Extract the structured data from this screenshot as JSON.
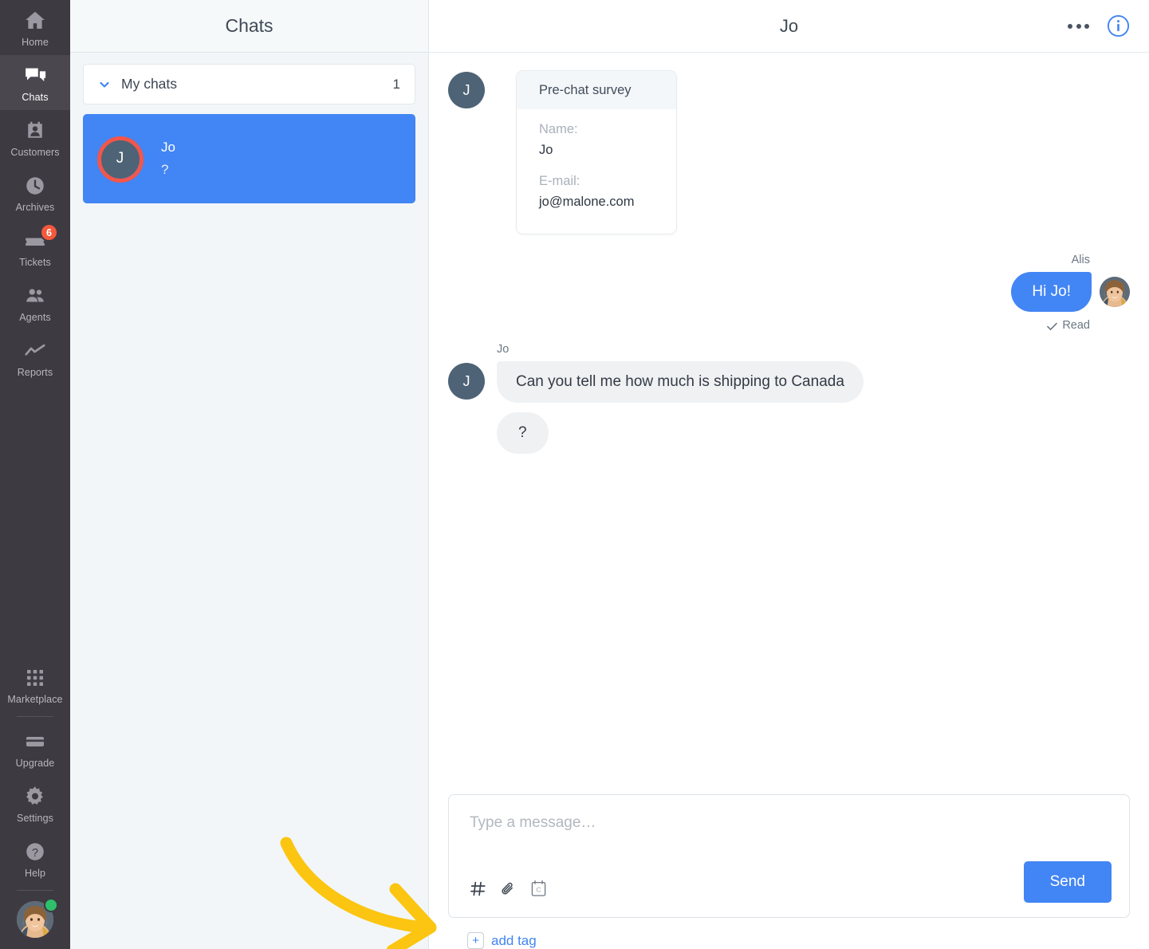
{
  "sidebar": {
    "items": [
      {
        "label": "Home",
        "icon": "home-icon",
        "active": false
      },
      {
        "label": "Chats",
        "icon": "chats-icon",
        "active": true
      },
      {
        "label": "Customers",
        "icon": "customers-icon",
        "active": false
      },
      {
        "label": "Archives",
        "icon": "archives-clock-icon",
        "active": false
      },
      {
        "label": "Tickets",
        "icon": "ticket-icon",
        "active": false,
        "badge": "6"
      },
      {
        "label": "Agents",
        "icon": "agents-icon",
        "active": false
      },
      {
        "label": "Reports",
        "icon": "reports-chart-icon",
        "active": false
      }
    ],
    "bottom_items": [
      {
        "label": "Marketplace",
        "icon": "grid-icon"
      },
      {
        "label": "Upgrade",
        "icon": "credit-card-icon"
      },
      {
        "label": "Settings",
        "icon": "gear-icon"
      },
      {
        "label": "Help",
        "icon": "question-circle-icon"
      }
    ],
    "profile": {
      "name": "agent-avatar",
      "status": "online"
    }
  },
  "chat_list": {
    "title": "Chats",
    "group": {
      "label": "My chats",
      "count": "1"
    },
    "items": [
      {
        "avatar_initial": "J",
        "name": "Jo",
        "preview": "?",
        "selected": true,
        "highlighted": true
      }
    ]
  },
  "conversation": {
    "title": "Jo",
    "actions": {
      "more": "more-options-icon",
      "info": "info-icon"
    },
    "survey": {
      "title": "Pre-chat survey",
      "avatar_initial": "J",
      "fields": [
        {
          "key": "Name:",
          "value": "Jo"
        },
        {
          "key": "E-mail:",
          "value": "jo@malone.com"
        }
      ]
    },
    "messages": [
      {
        "author": "Alis",
        "side": "agent",
        "text": "Hi Jo!",
        "status": "Read"
      },
      {
        "author": "Jo",
        "side": "customer",
        "avatar_initial": "J",
        "bubbles": [
          "Can you tell me how much is shipping to Canada",
          "?"
        ]
      }
    ]
  },
  "composer": {
    "placeholder": "Type a message…",
    "value": "",
    "tools": [
      "hash-tag-icon",
      "paperclip-attachment-icon",
      "canned-response-icon"
    ],
    "send_label": "Send",
    "tag": {
      "plus": "+",
      "label": "add tag"
    }
  },
  "annotations": {
    "arrow_color": "#fbc511",
    "highlight_ring_color": "#f2564b"
  },
  "colors": {
    "accent_blue": "#4285f4",
    "rail_bg": "#3d3a42",
    "list_bg": "#f2f6f8",
    "badge_red": "#f4593c",
    "online_green": "#2ec16b"
  }
}
